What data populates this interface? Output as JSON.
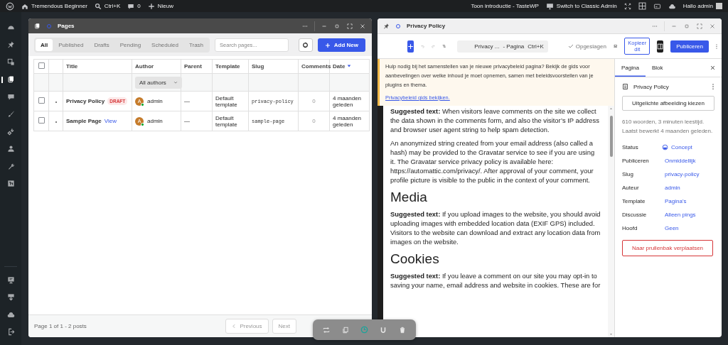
{
  "admin_bar": {
    "site_name": "Tremendous Beginner",
    "search_shortcut": "Ctrl+K",
    "comments_count": "0",
    "new_label": "Nieuw",
    "intro_link": "Toon introductie - TasteWP",
    "classic_admin": "Switch to Classic Admin",
    "greeting": "Hallo admin"
  },
  "sidebar": {
    "items": [
      {
        "selected": false
      },
      {
        "selected": false
      },
      {
        "selected": false
      },
      {
        "selected": true
      },
      {
        "selected": false
      },
      {
        "selected": false
      },
      {
        "selected": false
      },
      {
        "selected": false
      },
      {
        "selected": false
      },
      {
        "selected": false
      }
    ],
    "bottom_items": [
      {
        "selected": false
      },
      {
        "selected": false
      },
      {
        "selected": false
      },
      {
        "selected": false
      }
    ]
  },
  "pages_window": {
    "title": "Pages",
    "filters": [
      {
        "label": "All",
        "selected": true
      },
      {
        "label": "Published",
        "selected": false
      },
      {
        "label": "Drafts",
        "selected": false
      },
      {
        "label": "Pending",
        "selected": false
      },
      {
        "label": "Scheduled",
        "selected": false
      },
      {
        "label": "Trash",
        "selected": false
      }
    ],
    "search": {
      "placeholder": "Search pages..."
    },
    "add_new": "Add New",
    "table": {
      "select_all": {
        "checked": false
      },
      "columns": [
        {
          "label": "Title"
        },
        {
          "label": "Author"
        },
        {
          "label": "Parent"
        },
        {
          "label": "Template"
        },
        {
          "label": "Slug"
        },
        {
          "label": "Comments"
        },
        {
          "label": "Date",
          "sorted": true
        }
      ],
      "author_filter": "All authors",
      "rows": [
        {
          "checked": false,
          "title": "Privacy Policy",
          "badge": "DRAFT",
          "author": "admin",
          "avatar_letter": "A",
          "parent": "—",
          "template": "Default template",
          "slug": "privacy-policy",
          "comments": "0",
          "date": "4 maanden geleden"
        },
        {
          "checked": false,
          "title": "Sample Page",
          "link": "View",
          "author": "admin",
          "avatar_letter": "A",
          "parent": "—",
          "template": "Default template",
          "slug": "sample-page",
          "comments": "0",
          "date": "4 maanden geleden"
        }
      ]
    },
    "footer": {
      "summary": "Page 1 of 1 - 2 posts",
      "previous": "Previous",
      "next": "Next"
    }
  },
  "editor_window": {
    "title": "Privacy Policy",
    "toolbar": {
      "doc_title": "Privacy ...",
      "doc_type": "- Pagina",
      "shortcut": "Ctrl+K",
      "saved": "Opgeslagen",
      "copy": "Kopieer dit",
      "publish": "Publiceren"
    },
    "notice": {
      "text": "Hulp nodig bij het samenstellen van je nieuwe privacybeleid pagina? Bekijk de gids voor aanbevelingen over welke inhoud je moet opnemen, samen met beleidsvoorstellen van je plugins en thema.",
      "link": "Privacybeleid gids bekijken."
    },
    "content": [
      {
        "kind": "paragraph",
        "text": "**Suggested text:** When visitors leave comments on the site we collect the data shown in the comments form, and also the visitor’s IP address and browser user agent string to help spam detection."
      },
      {
        "kind": "paragraph",
        "text": "An anonymized string created from your email address (also called a hash) may be provided to the Gravatar service to see if you are using it. The Gravatar service privacy policy is available here: https://automattic.com/privacy/. After approval of your comment, your profile picture is visible to the public in the context of your comment."
      },
      {
        "kind": "heading",
        "text": "Media"
      },
      {
        "kind": "paragraph",
        "text": "**Suggested text:** If you upload images to the website, you should avoid uploading images with embedded location data (EXIF GPS) included. Visitors to the website can download and extract any location data from images on the website."
      },
      {
        "kind": "heading",
        "text": "Cookies"
      },
      {
        "kind": "paragraph",
        "text": "**Suggested text:** If you leave a comment on our site you may opt-in to saving your name, email address and website in cookies. These are for"
      }
    ],
    "sidebar": {
      "tabs": [
        {
          "label": "Pagina",
          "selected": true
        },
        {
          "label": "Blok",
          "selected": false
        }
      ],
      "doc_title": "Privacy Policy",
      "featured_image": "Uitgelichte afbeelding kiezen",
      "meta": [
        "610 woorden, 3 minuten leestijd.",
        "Laatst bewerkt 4 maanden geleden."
      ],
      "fields": [
        {
          "label": "Status",
          "value": "Concept",
          "kind": "status"
        },
        {
          "label": "Publiceren",
          "value": "Onmiddellijk",
          "kind": "link"
        },
        {
          "label": "Slug",
          "value": "privacy-policy",
          "kind": "link"
        },
        {
          "label": "Auteur",
          "value": "admin",
          "kind": "link"
        },
        {
          "label": "Template",
          "value": "Pagina's",
          "kind": "link"
        },
        {
          "label": "Discussie",
          "value": "Alleen pings",
          "kind": "link"
        },
        {
          "label": "Hoofd",
          "value": "Geen",
          "kind": "link"
        }
      ],
      "trash": "Naar prullenbak verplaatsen"
    }
  }
}
